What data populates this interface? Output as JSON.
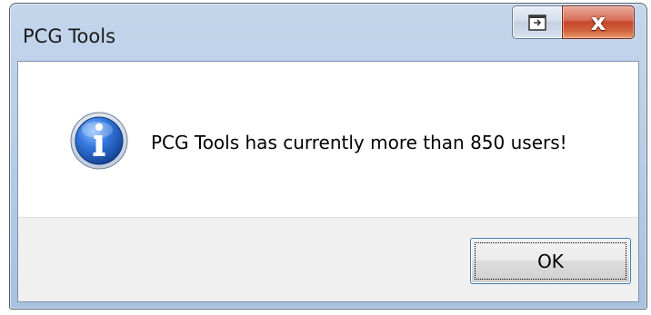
{
  "window": {
    "title": "PCG Tools",
    "title_icon": "none"
  },
  "caption_buttons": {
    "restore_icon": "window-restore-icon",
    "close_glyph": "x",
    "close_icon": "close-icon"
  },
  "dialog": {
    "icon": "information-icon",
    "message": "PCG Tools has currently more than 850 users!",
    "ok_label": "OK"
  },
  "colors": {
    "titlebar": "#b9cde6",
    "close_button": "#c6462d",
    "footer": "#f0f0f0",
    "info_icon": "#1f5ab5",
    "default_button_border": "#3c7fb1"
  }
}
